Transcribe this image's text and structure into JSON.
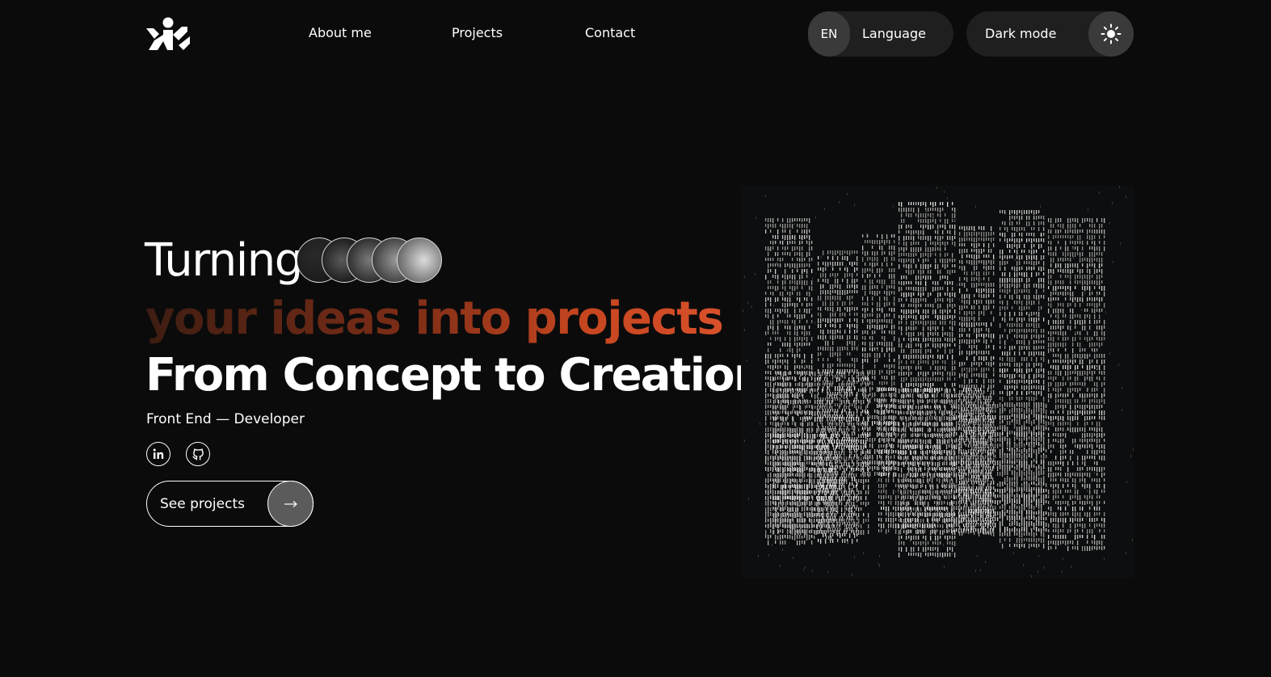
{
  "nav": {
    "items": [
      {
        "label": "About me"
      },
      {
        "label": "Projects"
      },
      {
        "label": "Contact"
      }
    ]
  },
  "language": {
    "code": "EN",
    "label": "Language"
  },
  "theme": {
    "label": "Dark mode",
    "icon": "sun-icon"
  },
  "hero": {
    "line1": "Turning",
    "line2": "your ideas into projects",
    "line3": "From Concept to Creation",
    "role": "Front End — Developer"
  },
  "social": {
    "linkedin_icon": "linkedin-icon",
    "github_icon": "github-icon"
  },
  "cta": {
    "label": "See projects",
    "icon": "arrow-right-icon"
  },
  "colors": {
    "background": "#0b0b0b",
    "pill": "#1f1f1f",
    "pill_accent": "#3a3a3a",
    "accent_gradient_start": "#3e1d12",
    "accent_gradient_end": "#d8502a"
  }
}
